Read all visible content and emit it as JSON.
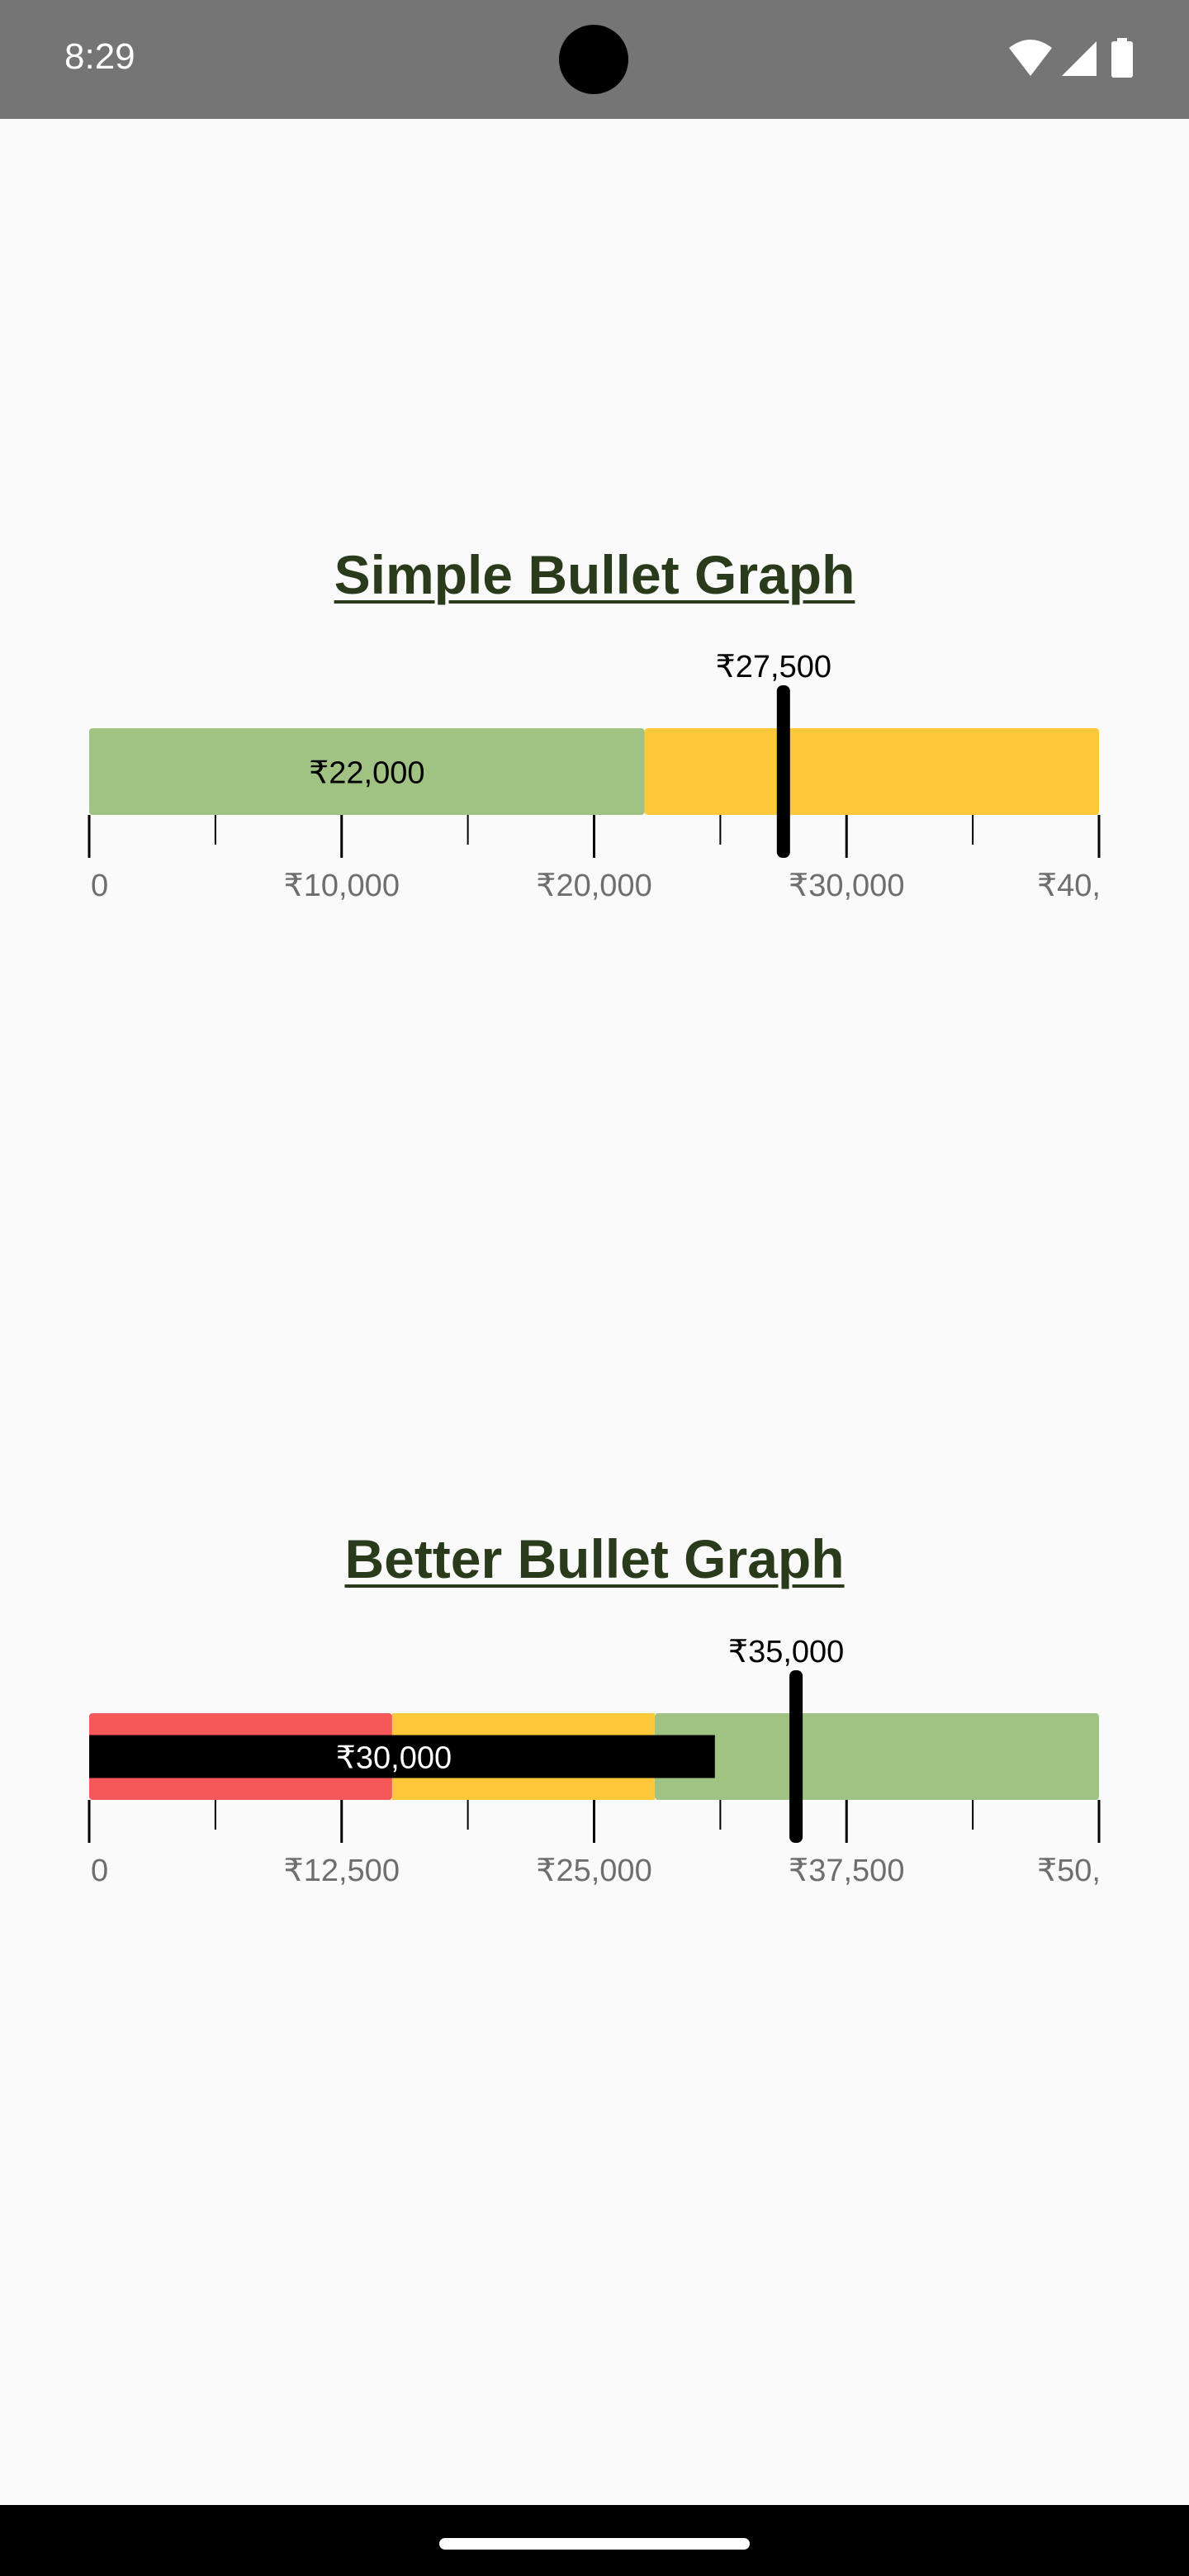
{
  "status_bar": {
    "time": "8:29",
    "icons": [
      "wifi-icon",
      "signal-icon",
      "battery-icon"
    ]
  },
  "chart_data": [
    {
      "type": "bullet",
      "title": "Simple Bullet Graph",
      "xlim": [
        0,
        40000
      ],
      "ticks": [
        0,
        10000,
        20000,
        30000,
        40000
      ],
      "tick_labels": [
        "0",
        "₹10,000",
        "₹20,000",
        "₹30,000",
        "₹40,"
      ],
      "minor_ticks": [
        5000,
        15000,
        25000,
        35000
      ],
      "ranges": [
        {
          "from": 0,
          "to": 22000,
          "color": "#a0c282",
          "label": "₹22,000",
          "label_color": "#000000"
        },
        {
          "from": 22000,
          "to": 40000,
          "color": "#fdc93a"
        }
      ],
      "target": {
        "value": 27500,
        "label": "₹27,500"
      }
    },
    {
      "type": "bullet",
      "title": "Better Bullet Graph",
      "xlim": [
        0,
        50000
      ],
      "ticks": [
        0,
        12500,
        25000,
        37500,
        50000
      ],
      "tick_labels": [
        "0",
        "₹12,500",
        "₹25,000",
        "₹37,500",
        "₹50,"
      ],
      "minor_ticks": [
        6250,
        18750,
        31250,
        43750
      ],
      "ranges": [
        {
          "from": 0,
          "to": 15000,
          "color": "#f45858"
        },
        {
          "from": 15000,
          "to": 28000,
          "color": "#fdc93a"
        },
        {
          "from": 28000,
          "to": 50000,
          "color": "#a0c282"
        }
      ],
      "measure": {
        "value": 30000,
        "label": "₹30,000",
        "color": "#000000",
        "label_color": "#ffffff"
      },
      "target": {
        "value": 35000,
        "label": "₹35,000"
      }
    }
  ]
}
